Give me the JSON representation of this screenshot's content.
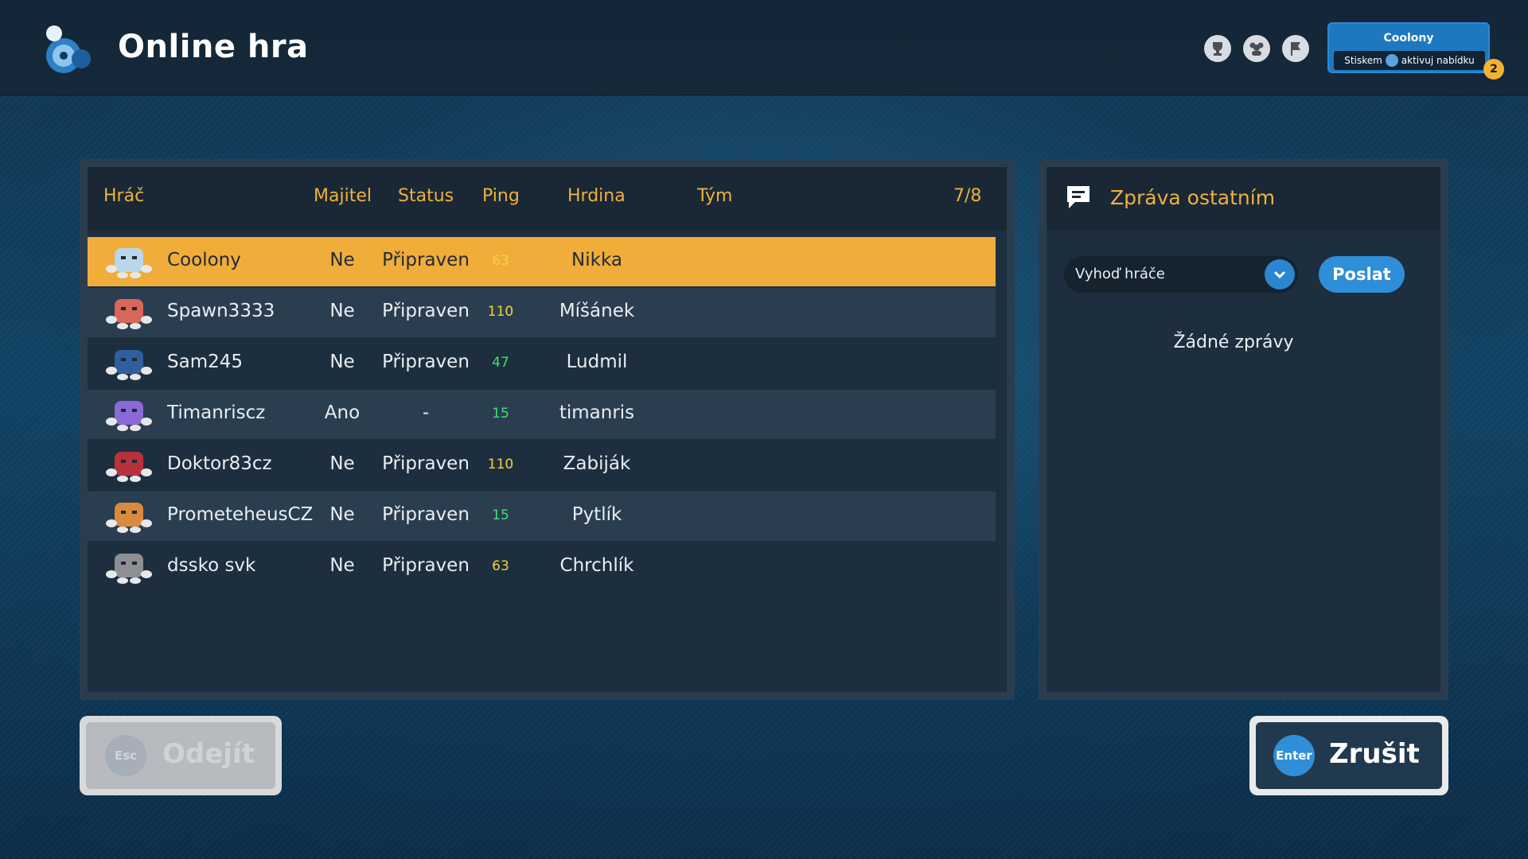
{
  "header": {
    "title": "Online hra",
    "icons": [
      "trophy-icon",
      "friends-icon",
      "flag-icon"
    ],
    "user": {
      "name": "Coolony",
      "hint_prefix": "Stiskem",
      "hint_suffix": "aktivuj nabídku",
      "notification_count": "2"
    }
  },
  "players": {
    "columns": {
      "player": "Hráč",
      "owner": "Majitel",
      "status": "Status",
      "ping": "Ping",
      "hero": "Hrdina",
      "team": "Tým",
      "count": "7/8"
    },
    "rows": [
      {
        "name": "Coolony",
        "owner": "Ne",
        "status": "Připraven",
        "ping": "63",
        "ping_color": "#f5d23a",
        "hero": "Nikka",
        "avatar_color": "#b9d7e8",
        "selected": true
      },
      {
        "name": "Spawn3333",
        "owner": "Ne",
        "status": "Připraven",
        "ping": "110",
        "ping_color": "#f5d23a",
        "hero": "Míšánek",
        "avatar_color": "#d9665a"
      },
      {
        "name": "Sam245",
        "owner": "Ne",
        "status": "Připraven",
        "ping": "47",
        "ping_color": "#3ee26a",
        "hero": "Ludmil",
        "avatar_color": "#2f5f9e"
      },
      {
        "name": "Timanriscz",
        "owner": "Ano",
        "status": "-",
        "ping": "15",
        "ping_color": "#3ee26a",
        "hero": "timanris",
        "avatar_color": "#8a6ad6"
      },
      {
        "name": "Doktor83cz",
        "owner": "Ne",
        "status": "Připraven",
        "ping": "110",
        "ping_color": "#f5d23a",
        "hero": "Zabiják",
        "avatar_color": "#b8323c"
      },
      {
        "name": "PrometeheusCZ",
        "owner": "Ne",
        "status": "Připraven",
        "ping": "15",
        "ping_color": "#3ee26a",
        "hero": "Pytlík",
        "avatar_color": "#d98a3e"
      },
      {
        "name": "dssko svk",
        "owner": "Ne",
        "status": "Připraven",
        "ping": "63",
        "ping_color": "#f5d23a",
        "hero": "Chrchlík",
        "avatar_color": "#8d8f92"
      }
    ]
  },
  "chat": {
    "title": "Zpráva ostatním",
    "kick_placeholder": "Vyhoď hráče",
    "send_label": "Poslat",
    "empty_text": "Žádné zprávy"
  },
  "footer": {
    "leave_key": "Esc",
    "leave_label": "Odejít",
    "cancel_key": "Enter",
    "cancel_label": "Zrušit"
  },
  "colors": {
    "accent": "#f0b13c",
    "selected_row": "#f0ad3a",
    "button_blue": "#2e8fd8"
  }
}
